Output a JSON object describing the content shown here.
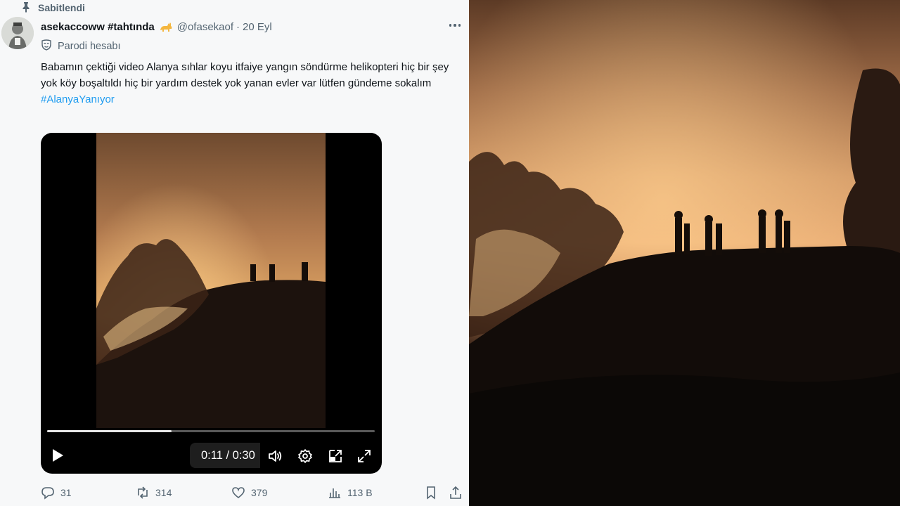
{
  "tweet": {
    "pinned_label": "Sabitlendi",
    "display_name": "asekaccoww #tahtında",
    "name_emoji": "cat-emoji",
    "handle": "@ofasekaof",
    "separator": "·",
    "date": "20 Eyl",
    "parody_label": "Parodi hesabı",
    "text": "Babamın çektiği video Alanya sıhlar koyu itfaiye yangın söndürme helikopteri hiç bir şey yok köy boşaltıldı hiç bir yardım destek yok yanan evler var lütfen gündeme sokalım",
    "hashtag": "#AlanyaYanıyor"
  },
  "video": {
    "current_time": "0:11",
    "duration": "0:30",
    "time_display": "0:11 / 0:30",
    "progress": 0.38,
    "icons": [
      "play-icon",
      "volume-icon",
      "settings-icon",
      "pip-icon",
      "fullscreen-icon"
    ]
  },
  "actions": {
    "replies": "31",
    "reposts": "314",
    "likes": "379",
    "views": "113 B"
  },
  "colors": {
    "accent": "#1d9bf0",
    "muted": "#536471",
    "text": "#0f1419",
    "panel": "#f7f8f9"
  }
}
